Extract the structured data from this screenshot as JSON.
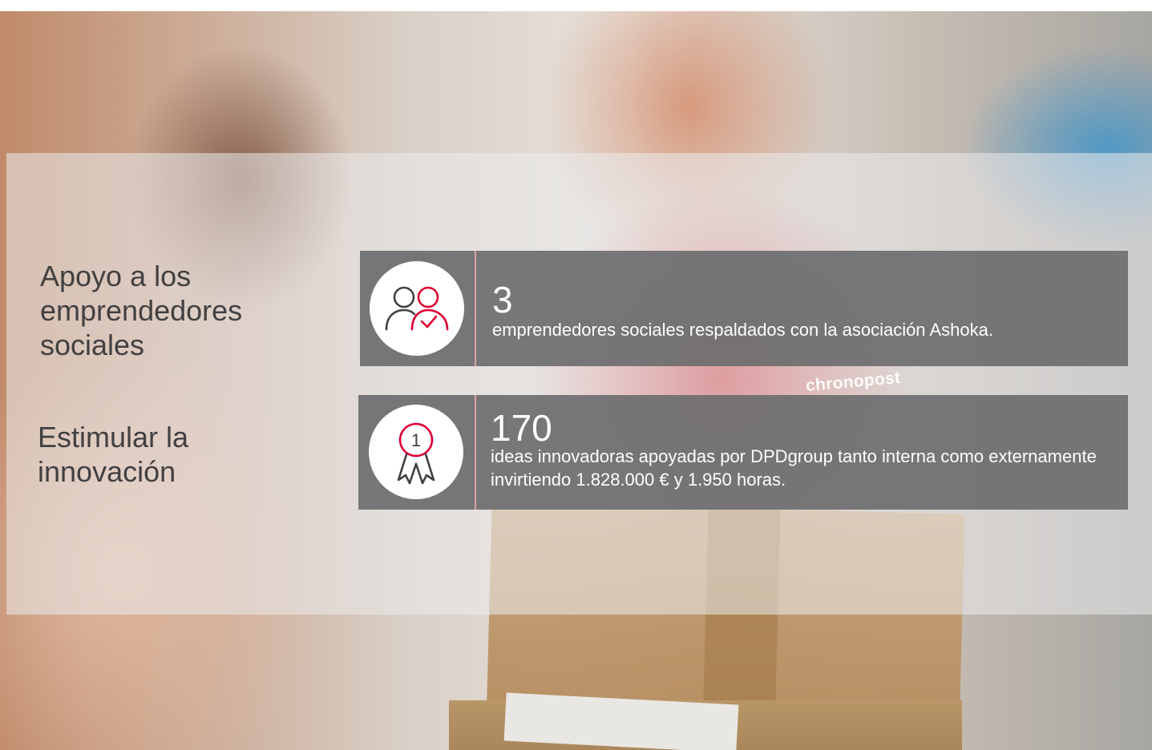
{
  "brand": {
    "accent": "#dc0032",
    "card_background": "#6e6e70",
    "heading_color": "#414042",
    "photo_watermark": "chronopost"
  },
  "sections": [
    {
      "heading": "Apoyo a los emprendedores sociales",
      "stat_value": "3",
      "stat_description": "emprendedores sociales respaldados con la asociación Ashoka.",
      "icon": "people-check-icon"
    },
    {
      "heading": "Estimular la innovación",
      "stat_value": "170",
      "stat_description": "ideas innovadoras apoyadas por DPDgroup tanto interna como externamente invirtiendo 1.828.000 € y 1.950 horas.",
      "icon": "award-ribbon-icon",
      "icon_badge": "1"
    }
  ]
}
